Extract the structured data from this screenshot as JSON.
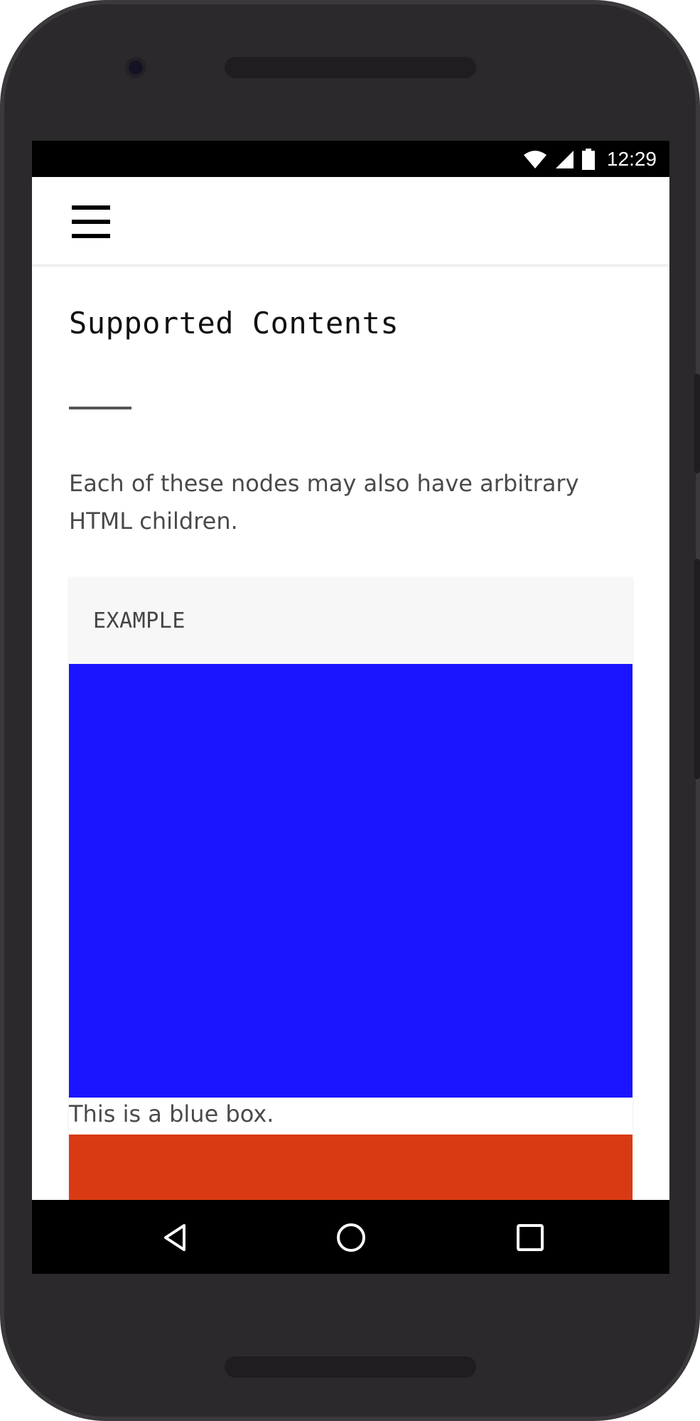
{
  "status": {
    "time": "12:29"
  },
  "appbar": {
    "menu_icon": "hamburger-menu-icon"
  },
  "page": {
    "title": "Supported Contents",
    "description": "Each of these nodes may also have arbitrary HTML children.",
    "example": {
      "label": "EXAMPLE",
      "caption": "This is a blue box."
    }
  },
  "colors": {
    "blue_box": "#1a14ff",
    "red_box": "#d93a14"
  },
  "navbar": {
    "back_icon": "back-triangle-icon",
    "home_icon": "home-circle-icon",
    "recents_icon": "recents-square-icon"
  }
}
